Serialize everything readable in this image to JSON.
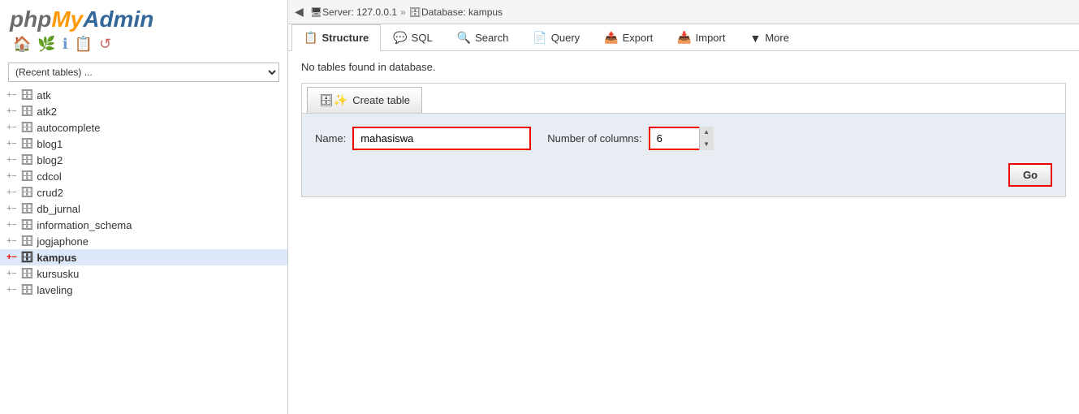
{
  "logo": {
    "php": "php",
    "my": "My",
    "admin": "Admin"
  },
  "logo_icons": [
    "🏠",
    "🌿",
    "ℹ",
    "📋",
    "↺"
  ],
  "recent_tables": {
    "placeholder": "(Recent tables) ..."
  },
  "sidebar": {
    "items": [
      {
        "label": "atk",
        "active": false
      },
      {
        "label": "atk2",
        "active": false
      },
      {
        "label": "autocomplete",
        "active": false
      },
      {
        "label": "blog1",
        "active": false
      },
      {
        "label": "blog2",
        "active": false
      },
      {
        "label": "cdcol",
        "active": false
      },
      {
        "label": "crud2",
        "active": false
      },
      {
        "label": "db_jurnal",
        "active": false
      },
      {
        "label": "information_schema",
        "active": false
      },
      {
        "label": "jogjaphone",
        "active": false
      },
      {
        "label": "kampus",
        "active": true
      },
      {
        "label": "kursusku",
        "active": false
      },
      {
        "label": "laveling",
        "active": false
      }
    ]
  },
  "topbar": {
    "server_label": "Server: 127.0.0.1",
    "separator": "»",
    "database_label": "Database: kampus"
  },
  "tabs": [
    {
      "id": "structure",
      "label": "Structure",
      "icon": "📋",
      "active": true
    },
    {
      "id": "sql",
      "label": "SQL",
      "icon": "💬",
      "active": false
    },
    {
      "id": "search",
      "label": "Search",
      "icon": "🔍",
      "active": false
    },
    {
      "id": "query",
      "label": "Query",
      "icon": "📄",
      "active": false
    },
    {
      "id": "export",
      "label": "Export",
      "icon": "📤",
      "active": false
    },
    {
      "id": "import",
      "label": "Import",
      "icon": "📥",
      "active": false
    },
    {
      "id": "more",
      "label": "More",
      "icon": "▼",
      "active": false
    }
  ],
  "content": {
    "no_tables_msg": "No tables found in database.",
    "create_table_btn": "Create table",
    "name_label": "Name:",
    "name_value": "mahasiswa",
    "cols_label": "Number of columns:",
    "cols_value": "6",
    "go_label": "Go"
  }
}
